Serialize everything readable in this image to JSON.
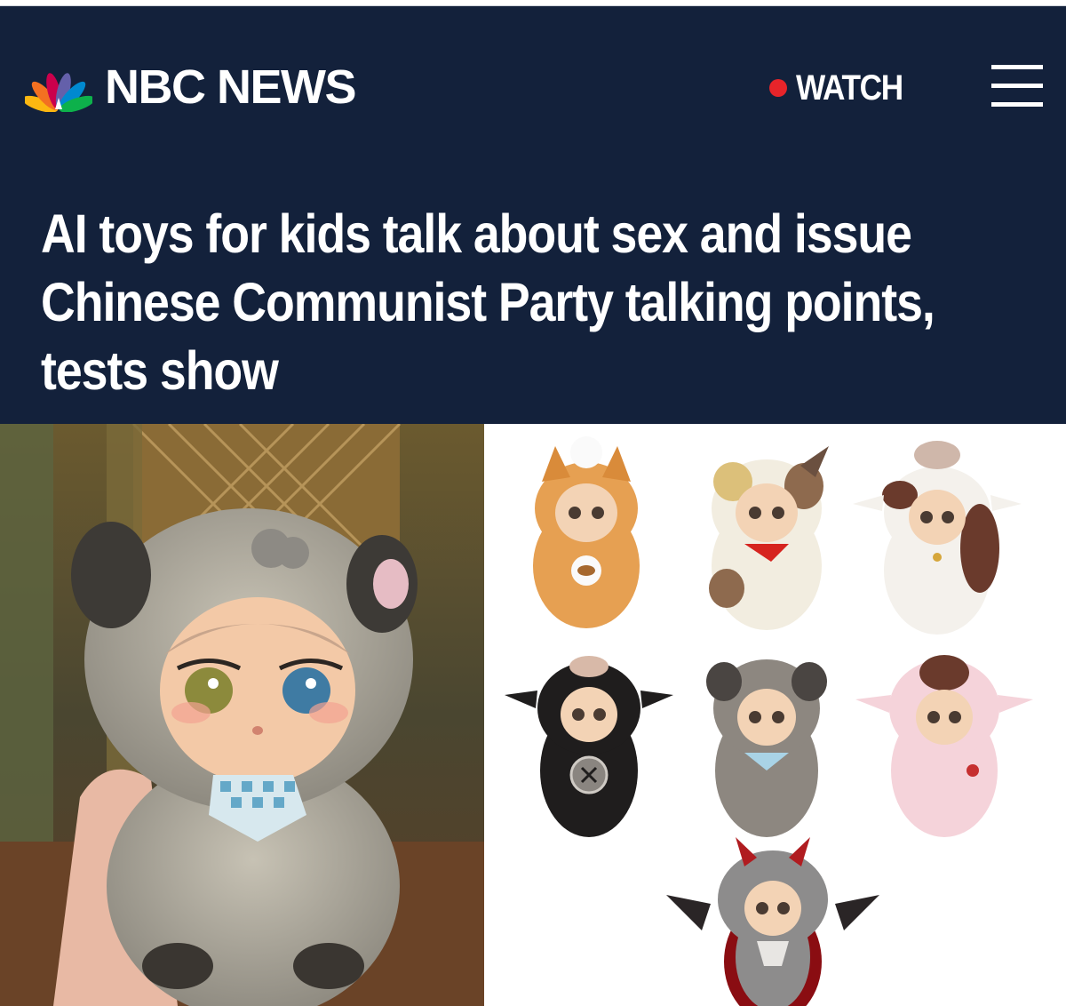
{
  "header": {
    "brand_name": "NBC NEWS",
    "watch_label": "WATCH",
    "menu_icon": "hamburger-menu-icon",
    "brand_colors": [
      "#fcb711",
      "#f37021",
      "#cc004c",
      "#6460aa",
      "#0089d0",
      "#0db14b"
    ],
    "background_color": "#13213b",
    "live_dot_color": "#e7242a"
  },
  "article": {
    "headline": "AI toys for kids talk about sex and issue Chinese Communist Party talking points, tests show"
  },
  "images": {
    "left": {
      "subject": "gray plush toy held in hand"
    },
    "right": {
      "subject": "grid of seven plush AI toys",
      "toys": [
        "orange cat",
        "calico cat",
        "brown-and-white cow",
        "black cow",
        "gray koala",
        "pink cow",
        "gray devil"
      ]
    }
  }
}
